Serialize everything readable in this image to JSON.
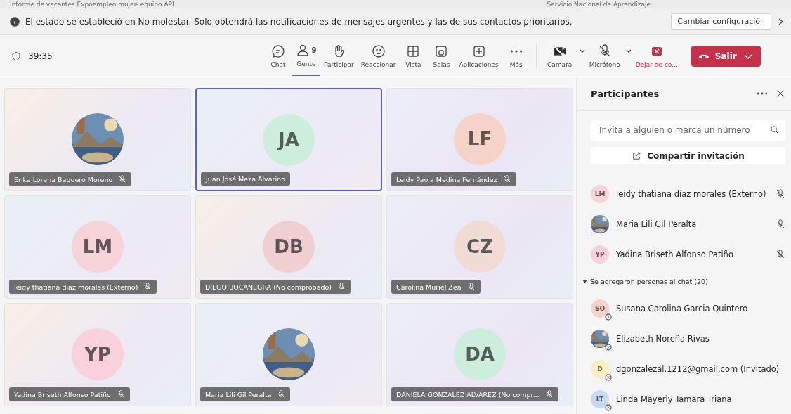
{
  "window": {
    "title": "Informe de vacantes Expoempleo mujer- equipo APL",
    "organization": "Servicio Nacional de Aprendizaje"
  },
  "notification": {
    "message": "El estado se estableció en No molestar. Solo obtendrá las notificaciones de mensajes urgentes y las de sus contactos prioritarios.",
    "button": "Cambiar configuración"
  },
  "toolbar": {
    "timer": "39:35",
    "items": [
      {
        "label": "Chat",
        "selected": false
      },
      {
        "label": "Gente",
        "badge": "9",
        "selected": true
      },
      {
        "label": "Participar",
        "selected": false
      },
      {
        "label": "Reaccionar",
        "selected": false
      },
      {
        "label": "Vista",
        "selected": false
      },
      {
        "label": "Salas",
        "selected": false
      },
      {
        "label": "Aplicaciones",
        "selected": false
      },
      {
        "label": "Más",
        "selected": false
      }
    ],
    "devices": [
      {
        "label": "Cámara",
        "kind": "camera"
      },
      {
        "label": "Micrófono",
        "kind": "mic"
      },
      {
        "label": "Dejar de co...",
        "kind": "share"
      }
    ],
    "leave": "Salir"
  },
  "tiles": [
    {
      "name": "Erika Lorena Baquero Moreno",
      "muted": true,
      "selected": false
    },
    {
      "kind": "initials",
      "initials": "JA",
      "color": "#cdeedd",
      "name": "Juan José Meza Alvarino",
      "muted": false,
      "selected": true
    },
    {
      "kind": "initials",
      "initials": "LF",
      "color": "#f6d3c8",
      "name": "Leidy Paola Medina Fernández",
      "muted": true,
      "selected": false
    },
    {
      "kind": "initials",
      "initials": "LM",
      "color": "#f6d3d9",
      "name": "leidy thatiana diaz morales (Externo)",
      "muted": true,
      "selected": false
    },
    {
      "kind": "initials",
      "initials": "DB",
      "color": "#efcfd2",
      "name": "DIEGO BOCANEGRA (No comprobado)",
      "muted": true,
      "selected": false
    },
    {
      "kind": "initials",
      "initials": "CZ",
      "color": "#f0dcd5",
      "name": "Carolina Muriel Zea",
      "muted": true,
      "selected": false
    },
    {
      "kind": "initials",
      "initials": "YP",
      "color": "#f8d1dc",
      "name": "Yadina Briseth Alfonso Patiño",
      "muted": true,
      "selected": false
    },
    {
      "name": "Maria Lili Gil Peralta",
      "muted": true,
      "selected": false
    },
    {
      "kind": "initials",
      "initials": "DA",
      "color": "#cdeedd",
      "name": "DANIELA GONZALEZ ALVAREZ (No compr...",
      "muted": true,
      "selected": false
    }
  ],
  "panel": {
    "title": "Participantes",
    "search": {
      "placeholder": "Invita a alguien o marca un número"
    },
    "share": "Compartir invitación",
    "people": [
      {
        "kind": "initials",
        "initials": "LM",
        "color": "#f6d3d9",
        "name": "leidy thatiana diaz morales (Externo)",
        "muted": true
      },
      {
        "name": "Maria Lili Gil Peralta",
        "muted": true
      },
      {
        "kind": "initials",
        "initials": "YP",
        "color": "#f8d1dc",
        "name": "Yadina Briseth Alfonso Patiño",
        "muted": true
      }
    ],
    "section": {
      "label": "Se agregaron personas al chat (20)",
      "expanded": true,
      "people": [
        {
          "kind": "initials",
          "initials": "SQ",
          "color": "#f6d3c8",
          "name": "Susana Carolina Garcia Quintero"
        },
        {
          "name": "Elizabeth Noreña Rivas"
        },
        {
          "kind": "initials",
          "initials": "D",
          "color": "#fbeec0",
          "name": "dgonzalezal.1212@gmail.com (Invitado)"
        },
        {
          "kind": "initials",
          "initials": "LT",
          "color": "#c9d9f0",
          "name": "Linda Mayerly Tamara Triana"
        }
      ]
    }
  }
}
